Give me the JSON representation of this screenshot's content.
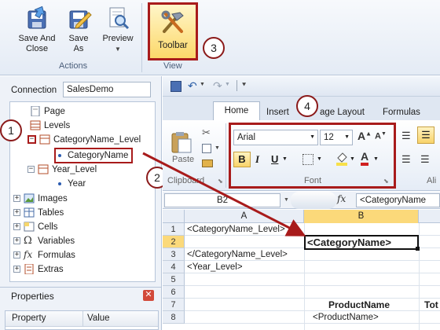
{
  "ribbon": {
    "save_and_close": "Save And Close",
    "save_as": "Save As",
    "preview": "Preview",
    "actions_label": "Actions",
    "toolbar": "Toolbar",
    "view_label": "View"
  },
  "connection": {
    "label": "Connection",
    "value": "SalesDemo"
  },
  "tree": {
    "page": "Page",
    "levels": "Levels",
    "category_level": "CategoryName_Level",
    "category_name": "CategoryName",
    "year_level": "Year_Level",
    "year": "Year",
    "images": "Images",
    "tables": "Tables",
    "cells": "Cells",
    "variables": "Variables",
    "formulas": "Formulas",
    "extras": "Extras"
  },
  "properties": {
    "title": "Properties",
    "col_property": "Property",
    "col_value": "Value"
  },
  "excel": {
    "tabs": {
      "home": "Home",
      "insert": "Insert",
      "page_layout": "age Layout",
      "formulas": "Formulas"
    },
    "font_name": "Arial",
    "font_size": "12",
    "paste": "Paste",
    "clipboard_label": "Clipboard",
    "font_label": "Font",
    "ali_label": "Ali",
    "name_box": "B2",
    "fx": "fx",
    "formula_value": "<CategoryName",
    "columns": [
      "A",
      "B",
      "Tot"
    ],
    "rows": [
      "1",
      "2",
      "3",
      "4",
      "5",
      "6",
      "7",
      "8"
    ],
    "cells": {
      "a1": "<CategoryName_Level>",
      "b2": "<CategoryName>",
      "a3": "</CategoryName_Level>",
      "a4": "<Year_Level>",
      "b7": "ProductName",
      "c7": "Tot",
      "b8": "<ProductName>"
    }
  },
  "callouts": [
    "1",
    "2",
    "3",
    "4"
  ],
  "colors": {
    "annotation_red": "#a81b1b",
    "ribbon_bg": "#e4ebf5",
    "selected_cell_bg": "#fde58a"
  }
}
